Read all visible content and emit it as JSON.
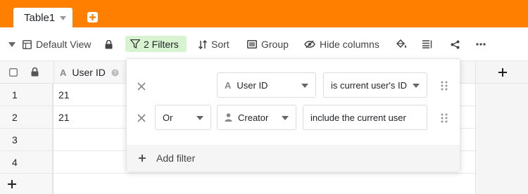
{
  "tabs": [
    {
      "label": "Table1"
    }
  ],
  "toolbar": {
    "view_label": "Default View",
    "filters_label": "2 Filters",
    "sort_label": "Sort",
    "group_label": "Group",
    "hide_columns_label": "Hide columns"
  },
  "grid": {
    "columns": [
      {
        "name": "User ID"
      }
    ],
    "rows": [
      {
        "num": "1",
        "user_id": "21"
      },
      {
        "num": "2",
        "user_id": "21"
      },
      {
        "num": "3",
        "user_id": ""
      },
      {
        "num": "4",
        "user_id": ""
      }
    ]
  },
  "filters": {
    "rows": [
      {
        "conjunction": "",
        "column": "User ID",
        "column_icon": "text-type-icon",
        "predicate": "is current user's ID"
      },
      {
        "conjunction": "Or",
        "column": "Creator",
        "column_icon": "person-icon",
        "predicate": "include the current user"
      }
    ],
    "add_label": "Add filter"
  },
  "colors": {
    "accent": "#ff8000",
    "filter_active_bg": "#d8f3d0"
  }
}
